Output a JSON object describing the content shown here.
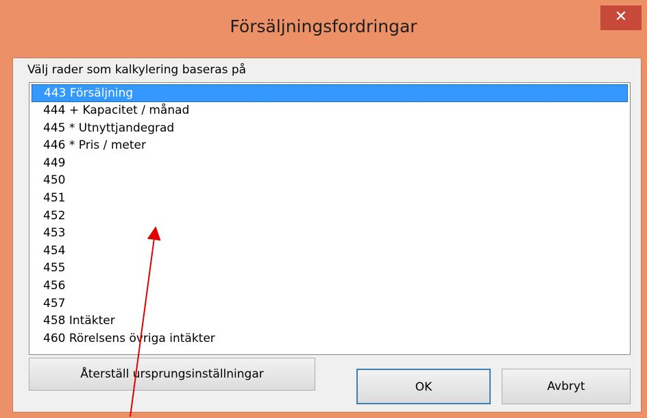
{
  "window": {
    "title": "Försäljningsfordringar",
    "close_glyph": "✕"
  },
  "list": {
    "label": "Välj rader som kalkylering baseras på",
    "items": [
      "443 Försäljning",
      "444 + Kapacitet / månad",
      "445 * Utnyttjandegrad",
      "446 * Pris / meter",
      "449",
      "450",
      "451",
      "452",
      "453",
      "454",
      "455",
      "456",
      "457",
      "458 Intäkter",
      "460 Rörelsens övriga intäkter"
    ],
    "selected_index": 0
  },
  "buttons": {
    "reset_label": "Återställ ursprungsinställningar",
    "ok_label": "OK",
    "cancel_label": "Avbryt"
  },
  "colors": {
    "frame": "#ec9067",
    "close_button": "#c7493a",
    "selection": "#3399ff",
    "annotation_arrow": "#e00000"
  }
}
